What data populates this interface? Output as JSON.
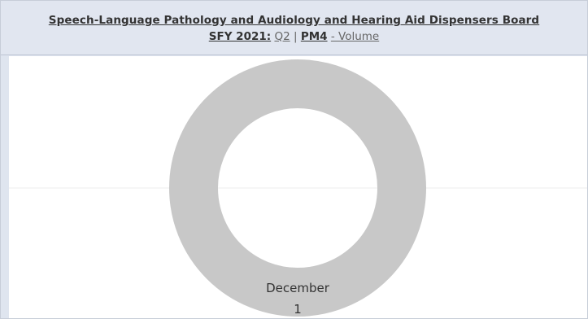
{
  "header": {
    "title": "Speech-Language Pathology and Audiology and Hearing Aid Dispensers Board",
    "sfy_label": "SFY 2021:",
    "quarter": "Q2",
    "separator": "|",
    "measure": "PM4",
    "measure_suffix": "- Volume"
  },
  "chart_data": {
    "type": "pie",
    "style": "donut",
    "categories": [
      "December"
    ],
    "values": [
      1
    ],
    "labels": [
      {
        "category": "December",
        "value": "1"
      }
    ],
    "colors": [
      "#c8c8c8"
    ]
  }
}
